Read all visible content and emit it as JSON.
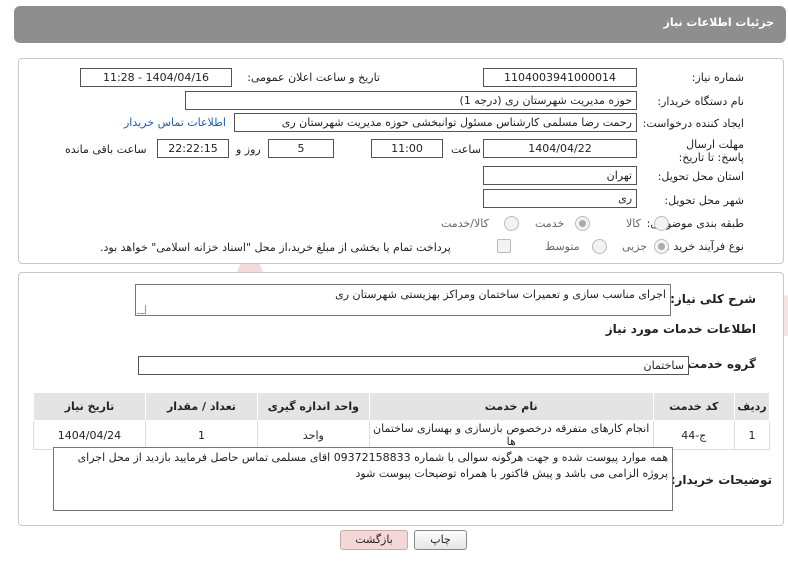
{
  "header": {
    "title": "جزئیات اطلاعات نیاز"
  },
  "form": {
    "need_number": {
      "label": "شماره نیاز:",
      "value": "1104003941000014"
    },
    "announce_datetime": {
      "label": "تاریخ و ساعت اعلان عمومی:",
      "value": "1404/04/16 - 11:28"
    },
    "buyer_org": {
      "label": "نام دستگاه خریدار:",
      "value": "حوزه مدیریت   شهرستان ری (درجه 1)"
    },
    "requester": {
      "label": "ایجاد کننده درخواست:",
      "value": "رحمت رضا مسلمی کارشناس مسئول توانبخشی حوزه مدیریت   شهرستان ری",
      "contact_link": "اطلاعات تماس خریدار"
    },
    "deadline": {
      "label": "مهلت ارسال پاسخ: تا تاریخ:",
      "date": "1404/04/22",
      "time_label": "ساعت",
      "time": "11:00",
      "days": "5",
      "days_label": "روز و",
      "remaining": "22:22:15",
      "remaining_label": "ساعت باقی مانده"
    },
    "province": {
      "label": "استان محل تحویل:",
      "value": "تهران"
    },
    "city": {
      "label": "شهر محل تحویل:",
      "value": "ری"
    },
    "category": {
      "label": "طبقه بندی موضوعی:",
      "options": [
        "کالا",
        "خدمت",
        "کالا/خدمت"
      ],
      "selected": "خدمت"
    },
    "purchase_type": {
      "label": "نوع فرآیند خرید :",
      "options": [
        "جزیی",
        "متوسط"
      ],
      "selected": "جزیی",
      "payment_note": "پرداخت تمام یا بخشی از مبلغ خرید،از محل \"اسناد خزانه اسلامی\" خواهد بود."
    }
  },
  "summary": {
    "label": "شرح کلی نیاز:",
    "value": "اجرای مناسب سازی و تعمیرات ساختمان ومراکز بهزیستی شهرستان ری"
  },
  "services": {
    "section_title": "اطلاعات خدمات مورد نیاز",
    "group_label": "گروه خدمت:",
    "group_value": "ساختمان",
    "columns": [
      "ردیف",
      "کد خدمت",
      "نام خدمت",
      "واحد اندازه گیری",
      "تعداد / مقدار",
      "تاریخ نیاز"
    ],
    "rows": [
      [
        "1",
        "ج-44",
        "انجام کارهای متفرقه درخصوص بازسازی و بهسازی ساختمان ها",
        "واحد",
        "1",
        "1404/04/24"
      ]
    ]
  },
  "buyer_notes": {
    "label": "توضیحات خریدار:",
    "value": "همه موارد پیوست شده و جهت هرگونه سوالی با شماره 09372158833 اقای مسلمی تماس حاصل فرمایید بازدید از محل اجرای پروژه الزامی می باشد و پیش فاکتور با همراه توضیحات پیوست شود"
  },
  "buttons": {
    "print": "چاپ",
    "back": "بازگشت"
  },
  "watermark": "AriaTender.net",
  "colors": {
    "header_bg": "#8e8e8e",
    "link": "#1a5fb4",
    "back_button": "#f4d7d7",
    "watermark": "#e2b3b3"
  }
}
